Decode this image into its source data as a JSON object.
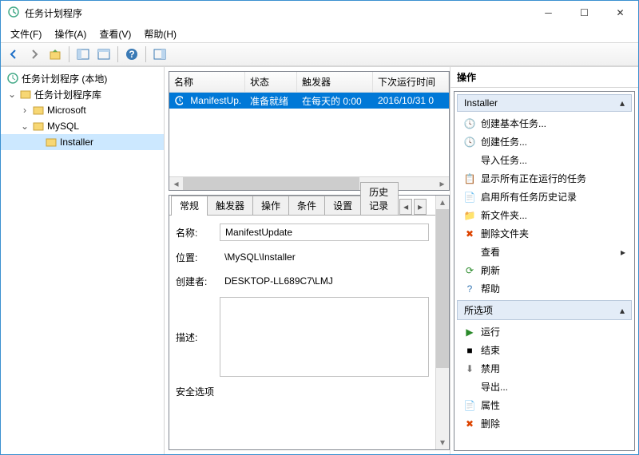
{
  "window": {
    "title": "任务计划程序"
  },
  "menu": {
    "file": "文件(F)",
    "action": "操作(A)",
    "view": "查看(V)",
    "help": "帮助(H)"
  },
  "tree": {
    "root": "任务计划程序 (本地)",
    "lib": "任务计划程序库",
    "ms": "Microsoft",
    "mysql": "MySQL",
    "installer": "Installer"
  },
  "list": {
    "cols": {
      "name": "名称",
      "status": "状态",
      "trigger": "触发器",
      "next": "下次运行时间"
    },
    "row": {
      "name": "ManifestUp...",
      "status": "准备就绪",
      "trigger": "在每天的 0:00",
      "next": "2016/10/31 0"
    }
  },
  "tabs": {
    "general": "常规",
    "triggers": "触发器",
    "actions": "操作",
    "conditions": "条件",
    "settings": "设置",
    "history": "历史记录"
  },
  "detail": {
    "name_l": "名称:",
    "name_v": "ManifestUpdate",
    "loc_l": "位置:",
    "loc_v": "\\MySQL\\Installer",
    "author_l": "创建者:",
    "author_v": "DESKTOP-LL689C7\\LMJ",
    "desc_l": "描述:",
    "secopt": "安全选项"
  },
  "actions": {
    "title": "操作",
    "section1": "Installer",
    "a1": "创建基本任务...",
    "a2": "创建任务...",
    "a3": "导入任务...",
    "a4": "显示所有正在运行的任务",
    "a5": "启用所有任务历史记录",
    "a6": "新文件夹...",
    "a7": "删除文件夹",
    "a8": "查看",
    "a9": "刷新",
    "a10": "帮助",
    "section2": "所选项",
    "b1": "运行",
    "b2": "结束",
    "b3": "禁用",
    "b4": "导出...",
    "b5": "属性",
    "b6": "删除"
  }
}
